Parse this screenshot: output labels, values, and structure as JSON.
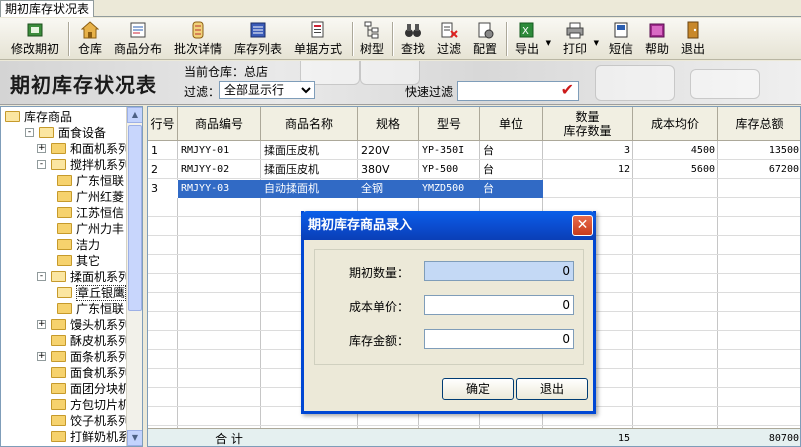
{
  "tab": {
    "label": "期初库存状况表"
  },
  "toolbar": {
    "items": [
      {
        "label": "修改期初",
        "icon": "edit-opening-icon"
      },
      {
        "label": "仓库",
        "icon": "warehouse-icon"
      },
      {
        "label": "商品分布",
        "icon": "distribution-icon"
      },
      {
        "label": "批次详情",
        "icon": "batch-icon"
      },
      {
        "label": "库存列表",
        "icon": "list-icon"
      },
      {
        "label": "单据方式",
        "icon": "document-icon"
      },
      {
        "label": "树型",
        "icon": "tree-icon"
      },
      {
        "label": "查找",
        "icon": "binoculars-icon"
      },
      {
        "label": "过滤",
        "icon": "filter-icon"
      },
      {
        "label": "配置",
        "icon": "config-icon"
      },
      {
        "label": "导出",
        "icon": "export-icon"
      },
      {
        "label": "打印",
        "icon": "printer-icon"
      },
      {
        "label": "短信",
        "icon": "sms-icon"
      },
      {
        "label": "帮助",
        "icon": "help-icon"
      },
      {
        "label": "退出",
        "icon": "exit-icon"
      }
    ]
  },
  "header": {
    "title": "期初库存状况表",
    "current_warehouse": "当前仓库：总店",
    "filter_label": "过滤：",
    "filter_value": "全部显示行",
    "quick_filter_label": "快速过滤",
    "quick_filter_value": ""
  },
  "tree": {
    "items": [
      {
        "label": "库存商品",
        "level": 0,
        "toggle": "",
        "open": true
      },
      {
        "label": "面食设备",
        "level": 1,
        "toggle": "−",
        "open": true
      },
      {
        "label": "和面机系列",
        "level": 2,
        "toggle": "+",
        "open": false
      },
      {
        "label": "搅拌机系列",
        "level": 2,
        "toggle": "−",
        "open": true
      },
      {
        "label": "广东恒联",
        "level": 3,
        "toggle": "",
        "open": false
      },
      {
        "label": "广州红菱",
        "level": 3,
        "toggle": "",
        "open": false
      },
      {
        "label": "江苏恒信",
        "level": 3,
        "toggle": "",
        "open": false
      },
      {
        "label": "广州力丰",
        "level": 3,
        "toggle": "",
        "open": false
      },
      {
        "label": "洁力",
        "level": 3,
        "toggle": "",
        "open": false
      },
      {
        "label": "其它",
        "level": 3,
        "toggle": "",
        "open": false
      },
      {
        "label": "揉面机系列",
        "level": 2,
        "toggle": "−",
        "open": true
      },
      {
        "label": "章丘银鹰",
        "level": 3,
        "toggle": "",
        "open": true
      },
      {
        "label": "广东恒联",
        "level": 3,
        "toggle": "",
        "open": false
      },
      {
        "label": "馒头机系列",
        "level": 2,
        "toggle": "+",
        "open": false
      },
      {
        "label": "酥皮机系列",
        "level": 2,
        "toggle": "",
        "open": false
      },
      {
        "label": "面条机系列",
        "level": 2,
        "toggle": "+",
        "open": false
      },
      {
        "label": "面食机系列",
        "level": 2,
        "toggle": "",
        "open": false
      },
      {
        "label": "面团分块机系列",
        "level": 2,
        "toggle": "",
        "open": false
      },
      {
        "label": "方包切片机系列",
        "level": 2,
        "toggle": "",
        "open": false
      },
      {
        "label": "饺子机系列",
        "level": 2,
        "toggle": "",
        "open": false
      },
      {
        "label": "打鲜奶机系列",
        "level": 2,
        "toggle": "",
        "open": false
      }
    ]
  },
  "grid": {
    "columns": [
      "行号",
      "商品编号",
      "商品名称",
      "规格",
      "型号",
      "单位",
      "数量\n库存数量",
      "成本均价",
      "库存总额"
    ],
    "rows": [
      {
        "no": "1",
        "code": "RMJYY-01",
        "name": "揉面压皮机",
        "spec": "220V",
        "model": "YP-350I",
        "unit": "台",
        "qty": "3",
        "price": "4500",
        "total": "13500"
      },
      {
        "no": "2",
        "code": "RMJYY-02",
        "name": "揉面压皮机",
        "spec": "380V",
        "model": "YP-500",
        "unit": "台",
        "qty": "12",
        "price": "5600",
        "total": "67200"
      },
      {
        "no": "3",
        "code": "RMJYY-03",
        "name": "自动揉面机",
        "spec": "全钢",
        "model": "YMZD500",
        "unit": "台",
        "qty": "",
        "price": "",
        "total": ""
      }
    ],
    "total_label": "合  计",
    "total_qty": "15",
    "total_amount": "80700"
  },
  "dialog": {
    "title": "期初库存商品录入",
    "fields": [
      {
        "label": "期初数量：",
        "value": "0"
      },
      {
        "label": "成本单价：",
        "value": "0"
      },
      {
        "label": "库存金额：",
        "value": "0"
      }
    ],
    "ok_label": "确定",
    "cancel_label": "退出"
  },
  "colors": {
    "selection": "#316ac5",
    "dialog_title": "#0b4dd1",
    "close": "#c73b1c"
  }
}
